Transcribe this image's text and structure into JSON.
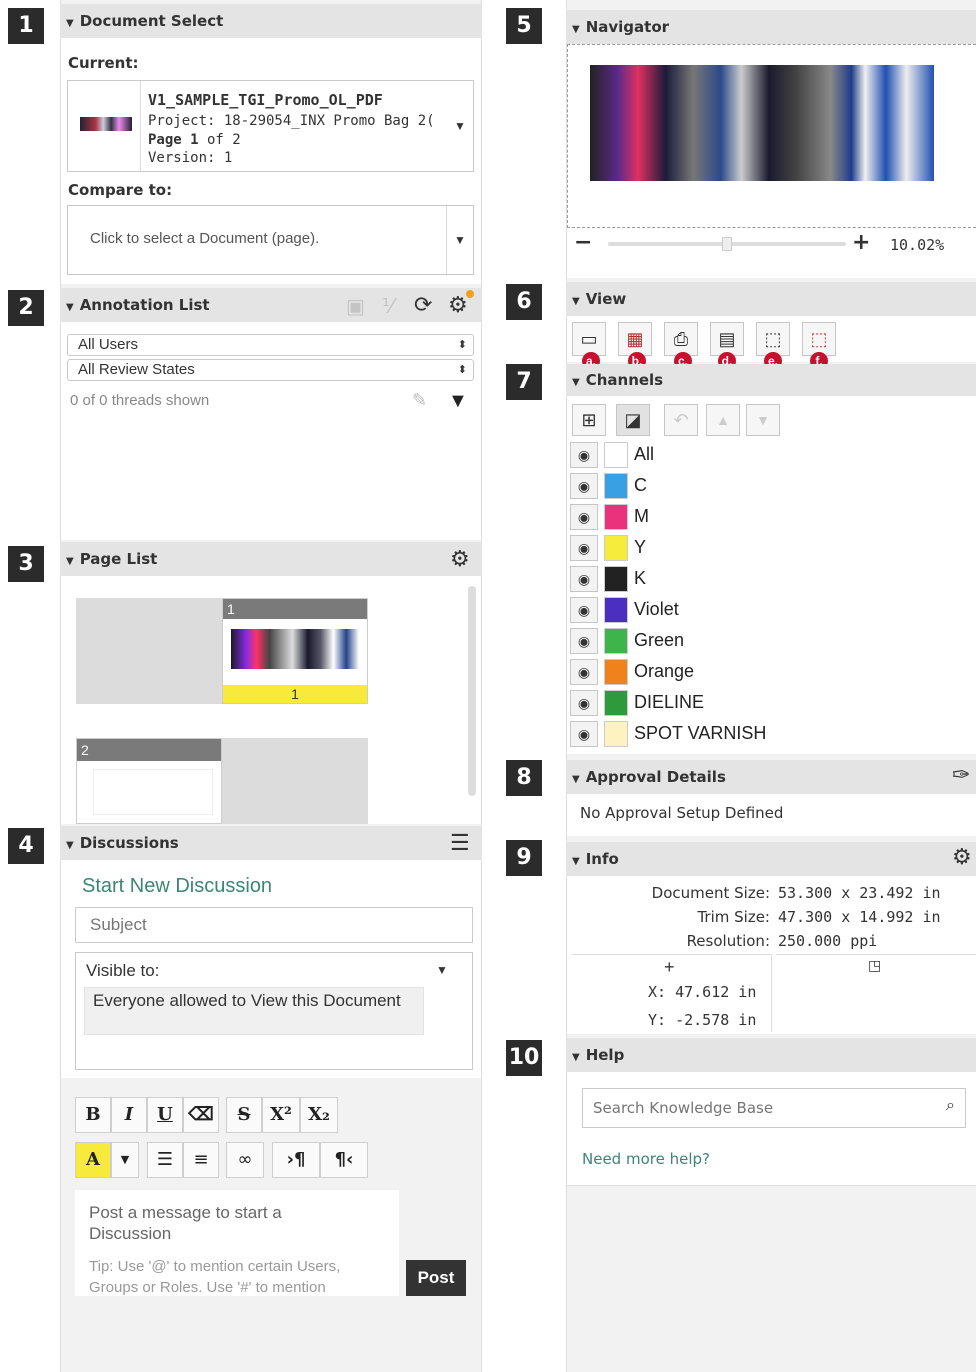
{
  "step_numbers": [
    "1",
    "2",
    "3",
    "4",
    "5",
    "6",
    "7",
    "8",
    "9",
    "10"
  ],
  "document_select": {
    "title": "Document Select",
    "current_label": "Current:",
    "doc_name": "V1_SAMPLE_TGI_Promo_OL_PDF",
    "project": "Project: 18-29054_INX Promo Bag 2(",
    "page_bold": "Page 1",
    "page_rest": " of 2",
    "version": "Version: 1",
    "compare_label": "Compare to:",
    "compare_placeholder": "Click to select a Document (page)."
  },
  "annotation_list": {
    "title": "Annotation List",
    "users_select": "All Users",
    "states_select": "All Review States",
    "threads_shown": "0 of 0 threads shown"
  },
  "page_list": {
    "title": "Page List",
    "pages": [
      {
        "number": "1",
        "label": "1"
      },
      {
        "number": "2"
      }
    ]
  },
  "discussions": {
    "title": "Discussions",
    "start_new": "Start New Discussion",
    "subject_placeholder": "Subject",
    "visible_to_label": "Visible to:",
    "visible_to_value": "Everyone allowed to View this Document",
    "editor_buttons_row1": [
      "B",
      "I",
      "U",
      "⌫",
      "S",
      "X²",
      "X₂"
    ],
    "message_placeholder": "Post a message to start a Discussion",
    "tip": "Tip: Use '@' to mention certain Users, Groups or Roles. Use '#' to mention",
    "post_label": "Post"
  },
  "navigator": {
    "title": "Navigator",
    "zoom_minus": "−",
    "zoom_plus": "+",
    "zoom_level": "10.02%",
    "zoom_fraction": 0.5
  },
  "view": {
    "title": "View",
    "markers": [
      "a.",
      "b.",
      "c.",
      "d.",
      "e.",
      "f."
    ]
  },
  "channels": {
    "title": "Channels",
    "items": [
      {
        "label": "All",
        "color": "#ffffff"
      },
      {
        "label": "C",
        "color": "#3aa0e4"
      },
      {
        "label": "M",
        "color": "#e8327c"
      },
      {
        "label": "Y",
        "color": "#f6ec3c"
      },
      {
        "label": "K",
        "color": "#222222"
      },
      {
        "label": "Violet",
        "color": "#4a2fc0"
      },
      {
        "label": "Green",
        "color": "#3db54a"
      },
      {
        "label": "Orange",
        "color": "#f0821e"
      },
      {
        "label": "DIELINE",
        "color": "#2e9a3c"
      },
      {
        "label": "SPOT VARNISH",
        "color": "#fdf3c0"
      }
    ]
  },
  "approval_details": {
    "title": "Approval Details",
    "message": "No Approval Setup Defined"
  },
  "info": {
    "title": "Info",
    "document_size_label": "Document Size:",
    "document_size_value": "53.300 x 23.492 in",
    "trim_size_label": "Trim Size:",
    "trim_size_value": "47.300 x 14.992 in",
    "resolution_label": "Resolution:",
    "resolution_value": "250.000  ppi",
    "x_coord": "X: 47.612 in",
    "y_coord": "Y: -2.578 in"
  },
  "help": {
    "title": "Help",
    "search_placeholder": "Search Knowledge Base",
    "more_help": "Need more help?"
  }
}
